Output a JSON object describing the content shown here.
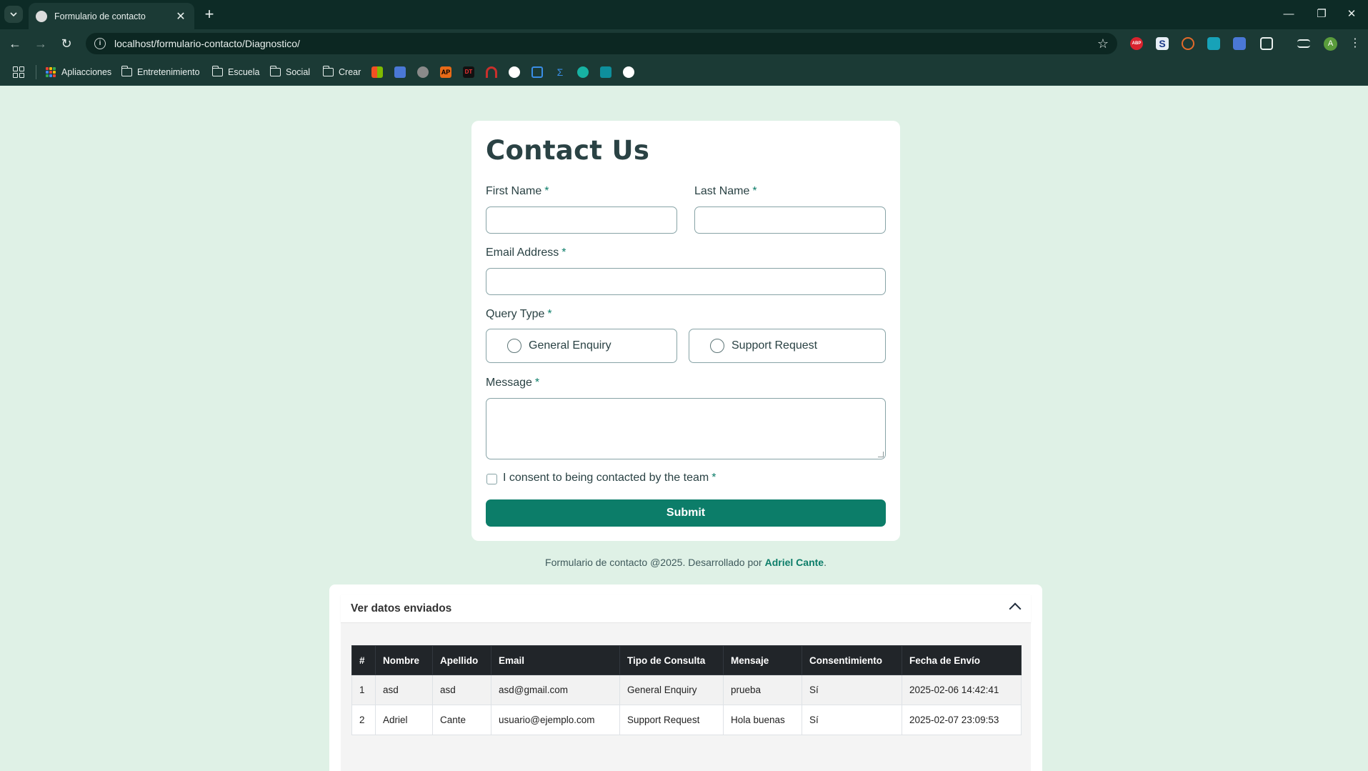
{
  "browser": {
    "tab_title": "Formulario de contacto",
    "url": "localhost/formulario-contacto/Diagnostico/",
    "profile_initial": "A",
    "bookmarks": [
      "Apliacciones",
      "Entretenimiento",
      "Escuela",
      "Social",
      "Crear"
    ],
    "bookmark_badges": {
      "abp": "ABP",
      "ap": "AP",
      "dt": "DT"
    }
  },
  "form": {
    "title": "Contact Us",
    "required_mark": "*",
    "first_name_label": "First Name",
    "last_name_label": "Last Name",
    "email_label": "Email Address",
    "query_type_label": "Query Type",
    "query_options": [
      "General Enquiry",
      "Support Request"
    ],
    "message_label": "Message",
    "consent_label": "I consent to being contacted by the team",
    "submit_label": "Submit"
  },
  "footer": {
    "text": "Formulario de contacto @2025. Desarrollado por ",
    "author": "Adriel Cante",
    "end": "."
  },
  "submissions": {
    "title": "Ver datos enviados",
    "columns": [
      "#",
      "Nombre",
      "Apellido",
      "Email",
      "Tipo de Consulta",
      "Mensaje",
      "Consentimiento",
      "Fecha de Envío"
    ],
    "rows": [
      [
        "1",
        "asd",
        "asd",
        "asd@gmail.com",
        "General Enquiry",
        "prueba",
        "Sí",
        "2025-02-06 14:42:41"
      ],
      [
        "2",
        "Adriel",
        "Cante",
        "usuario@ejemplo.com",
        "Support Request",
        "Hola buenas",
        "Sí",
        "2025-02-07 23:09:53"
      ]
    ]
  },
  "colors": {
    "page_bg": "#dff1e6",
    "accent": "#0c7d69",
    "chrome_dark": "#0d2b26",
    "table_header": "#212529"
  }
}
